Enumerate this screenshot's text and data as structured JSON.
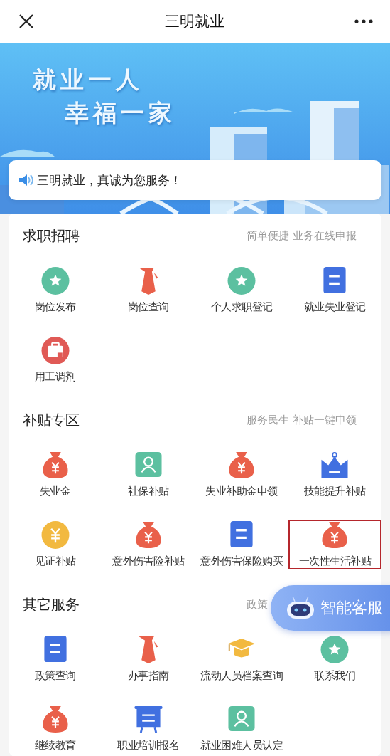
{
  "window": {
    "title": "三明就业"
  },
  "banner": {
    "lines": [
      "就业一人",
      "幸福一家"
    ]
  },
  "notice": {
    "text": "三明就业，真诚为您服务！"
  },
  "sections": [
    {
      "title": "求职招聘",
      "subtitle": "简单便捷 业务在线申报",
      "items": [
        {
          "label": "岗位发布",
          "kind": "star",
          "highlighted": false
        },
        {
          "label": "岗位查询",
          "kind": "tie",
          "highlighted": false
        },
        {
          "label": "个人求职登记",
          "kind": "star",
          "highlighted": false
        },
        {
          "label": "就业失业登记",
          "kind": "doc",
          "highlighted": false
        },
        {
          "label": "用工调剂",
          "kind": "briefcase",
          "highlighted": false
        }
      ]
    },
    {
      "title": "补贴专区",
      "subtitle": "服务民生 补贴一键申领",
      "items": [
        {
          "label": "失业金",
          "kind": "moneybag",
          "highlighted": false
        },
        {
          "label": "社保补贴",
          "kind": "person",
          "highlighted": false
        },
        {
          "label": "失业补助金申领",
          "kind": "moneybag",
          "highlighted": false
        },
        {
          "label": "技能提升补贴",
          "kind": "crown",
          "highlighted": false
        },
        {
          "label": "见证补贴",
          "kind": "coin",
          "highlighted": false
        },
        {
          "label": "意外伤害险补贴",
          "kind": "moneybag",
          "highlighted": false
        },
        {
          "label": "意外伤害保险购买",
          "kind": "doc",
          "highlighted": false
        },
        {
          "label": "一次性生活补贴",
          "kind": "moneybag",
          "highlighted": true
        }
      ]
    },
    {
      "title": "其它服务",
      "subtitle": "政策",
      "items": [
        {
          "label": "政策查询",
          "kind": "doc",
          "highlighted": false
        },
        {
          "label": "办事指南",
          "kind": "tie",
          "highlighted": false
        },
        {
          "label": "流动人员档案查询",
          "kind": "cap",
          "highlighted": false
        },
        {
          "label": "联系我们",
          "kind": "star",
          "highlighted": false
        },
        {
          "label": "继续教育",
          "kind": "moneybag",
          "highlighted": false
        },
        {
          "label": "职业培训报名",
          "kind": "easel",
          "highlighted": false
        },
        {
          "label": "就业困难人员认定",
          "kind": "person",
          "highlighted": false
        }
      ]
    }
  ],
  "assistant": {
    "label": "智能客服"
  }
}
